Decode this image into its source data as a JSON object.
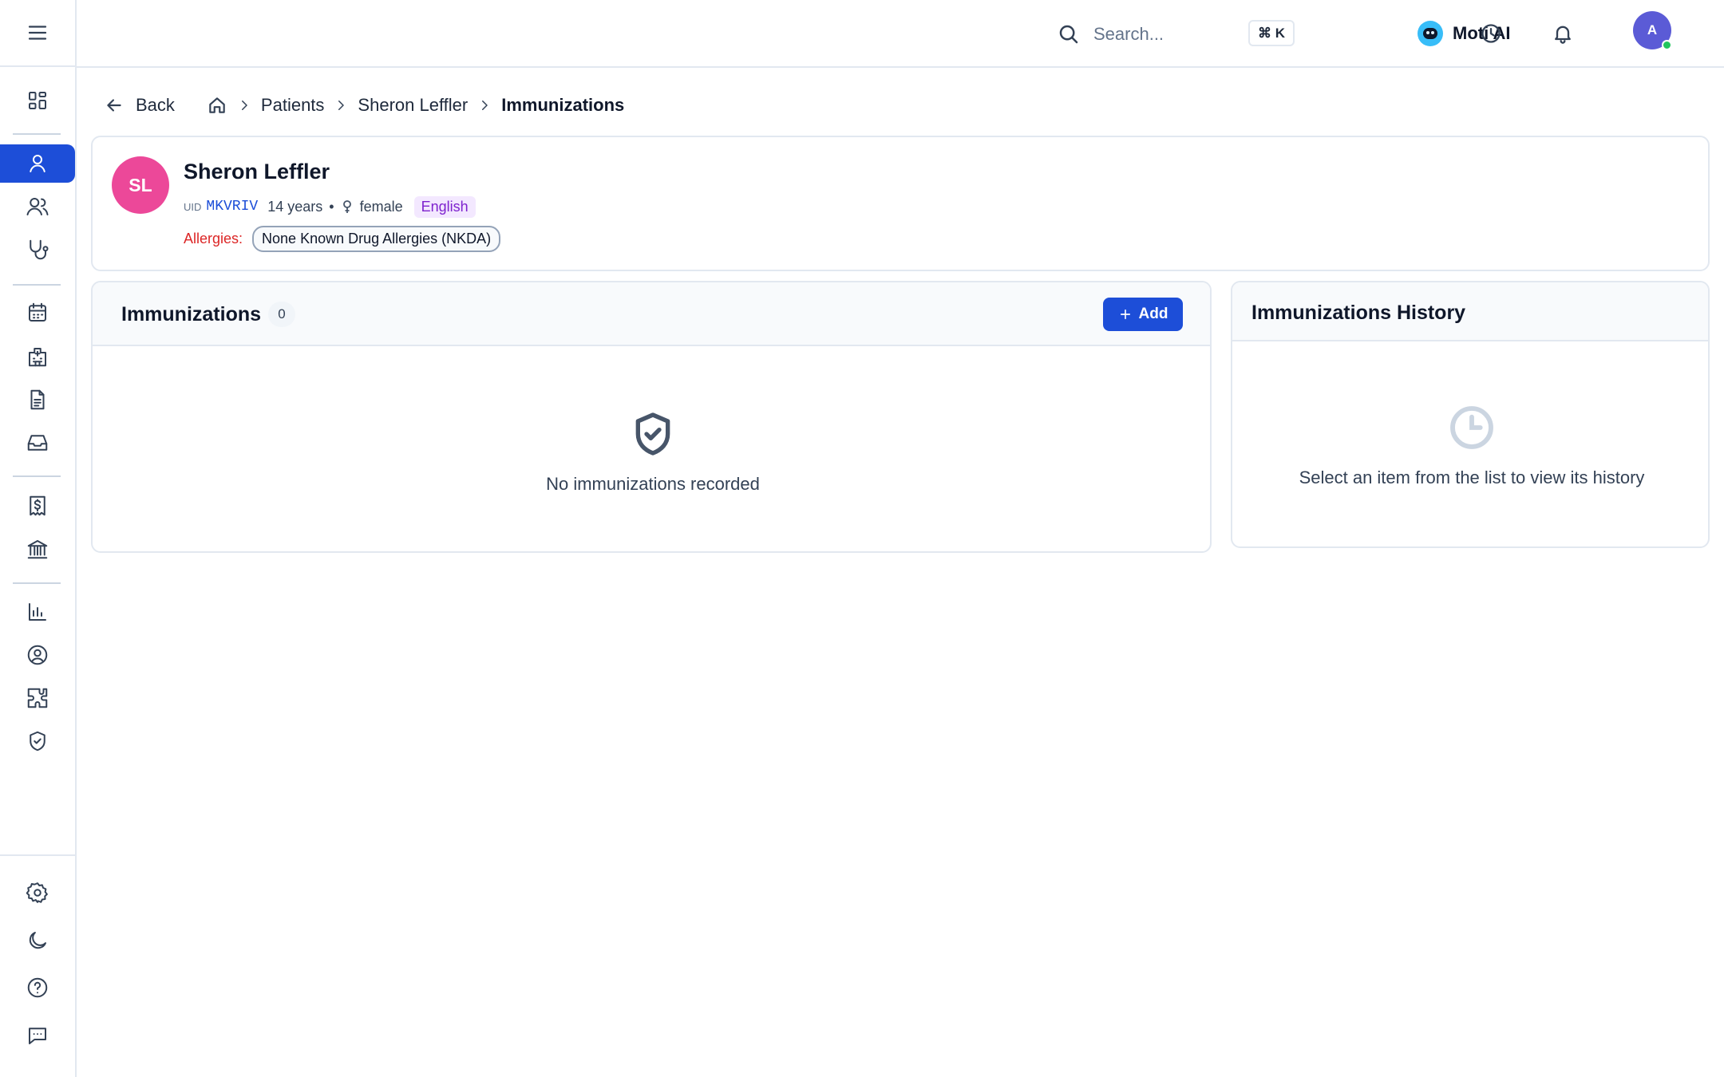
{
  "topbar": {
    "search_placeholder": "Search...",
    "shortcut": "⌘ K",
    "moti_label": "Moti AI",
    "user_initial": "A"
  },
  "breadcrumb": {
    "back_label": "Back",
    "items": [
      "Patients",
      "Sheron Leffler"
    ],
    "current": "Immunizations"
  },
  "patient": {
    "initials": "SL",
    "name": "Sheron Leffler",
    "uid_label": "UID",
    "uid": "MKVRIV",
    "age": "14 years",
    "gender": "female",
    "language": "English",
    "allergies_label": "Allergies:",
    "allergy": "None Known Drug Allergies (NKDA)"
  },
  "immunizations": {
    "title": "Immunizations",
    "count": "0",
    "add_label": "Add",
    "empty_text": "No immunizations recorded"
  },
  "history": {
    "title": "Immunizations History",
    "empty_text": "Select an item from the list to view its history"
  },
  "colors": {
    "accent": "#1d4ed8",
    "avatar_patient": "#ec4899",
    "avatar_user": "#5b5bd6",
    "allergy_label": "#dc2626",
    "language_badge": "#7e22ce"
  }
}
